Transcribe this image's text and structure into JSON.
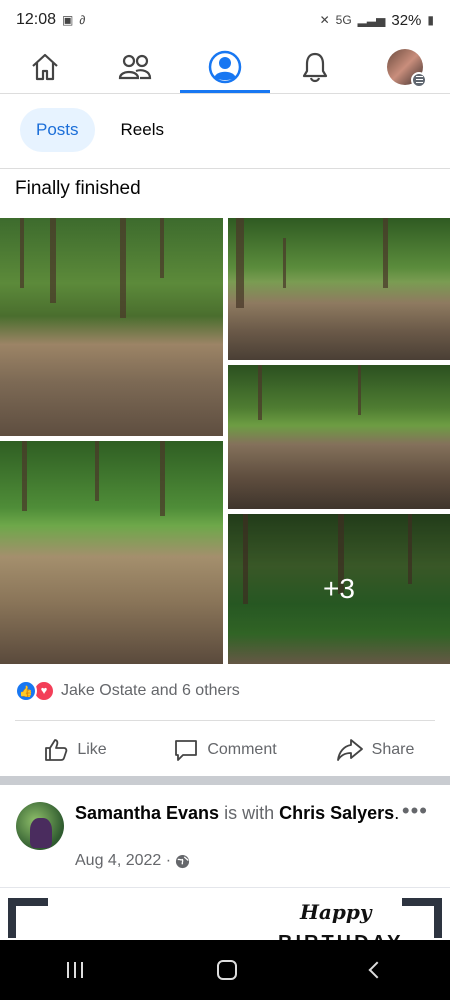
{
  "status_bar": {
    "time": "12:08",
    "network": "5G",
    "battery": "32%"
  },
  "top_nav": {
    "items": [
      {
        "icon": "home-icon"
      },
      {
        "icon": "friends-icon"
      },
      {
        "icon": "profile-icon",
        "active": true
      },
      {
        "icon": "bell-icon"
      },
      {
        "icon": "menu-avatar"
      }
    ],
    "accent_color": "#1877f2"
  },
  "tabs": {
    "posts": "Posts",
    "reels": "Reels"
  },
  "post1": {
    "text": "Finally finished",
    "more_photos": "+3",
    "reactions_text": "Jake Ostate and 6 others",
    "like_label": "Like",
    "comment_label": "Comment",
    "share_label": "Share"
  },
  "post2": {
    "author": "Samantha Evans",
    "with_text": "is with",
    "tagged": "Chris Salyers",
    "period": ".",
    "date": "Aug 4, 2022 ·",
    "more": "•••",
    "image_text_1": "Happy",
    "image_text_2": "BIRTHDAY"
  }
}
